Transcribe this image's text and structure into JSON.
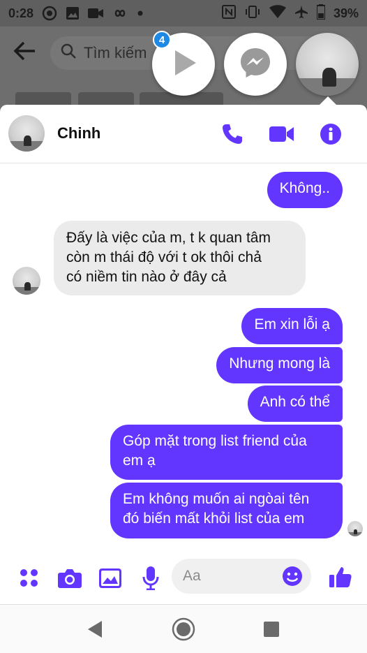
{
  "status_bar": {
    "time": "0:28",
    "battery": "39%",
    "icons": [
      "camera-shutter-icon",
      "image-icon",
      "video-icon",
      "infinity-icon",
      "dot-icon",
      "nfc-icon",
      "vibrate-icon",
      "wifi-icon",
      "airplane-icon",
      "battery-icon"
    ]
  },
  "background": {
    "search_placeholder": "Tìm kiếm"
  },
  "chat_heads": {
    "unread_count": "4"
  },
  "chat": {
    "contact_name": "Chinh",
    "actions": [
      "phone-icon",
      "video-call-icon",
      "info-icon"
    ],
    "messages": [
      {
        "side": "out",
        "text": "Không.."
      },
      {
        "side": "in",
        "lines": [
          "Đấy là việc của m, t k quan tâm",
          "còn m thái độ với t ok thôi chả",
          "có niềm tin nào ở đây cả"
        ]
      },
      {
        "side": "out",
        "text": "Em xin lỗi ạ"
      },
      {
        "side": "out",
        "text": "Nhưng mong là"
      },
      {
        "side": "out",
        "text": "Anh có thể"
      },
      {
        "side": "out",
        "lines": [
          "Góp mặt trong list friend của",
          "em ạ"
        ]
      },
      {
        "side": "out",
        "lines": [
          "Em không muốn ai ngòai tên",
          "đó biến mất khỏi list của em"
        ]
      }
    ]
  },
  "composer": {
    "placeholder": "Aa",
    "icons": [
      "apps-icon",
      "camera-icon",
      "gallery-icon",
      "mic-icon",
      "emoji-icon",
      "like-icon"
    ]
  },
  "colors": {
    "accent": "#6236ff",
    "incoming_bubble": "#ebebeb",
    "badge": "#1e88e5"
  }
}
